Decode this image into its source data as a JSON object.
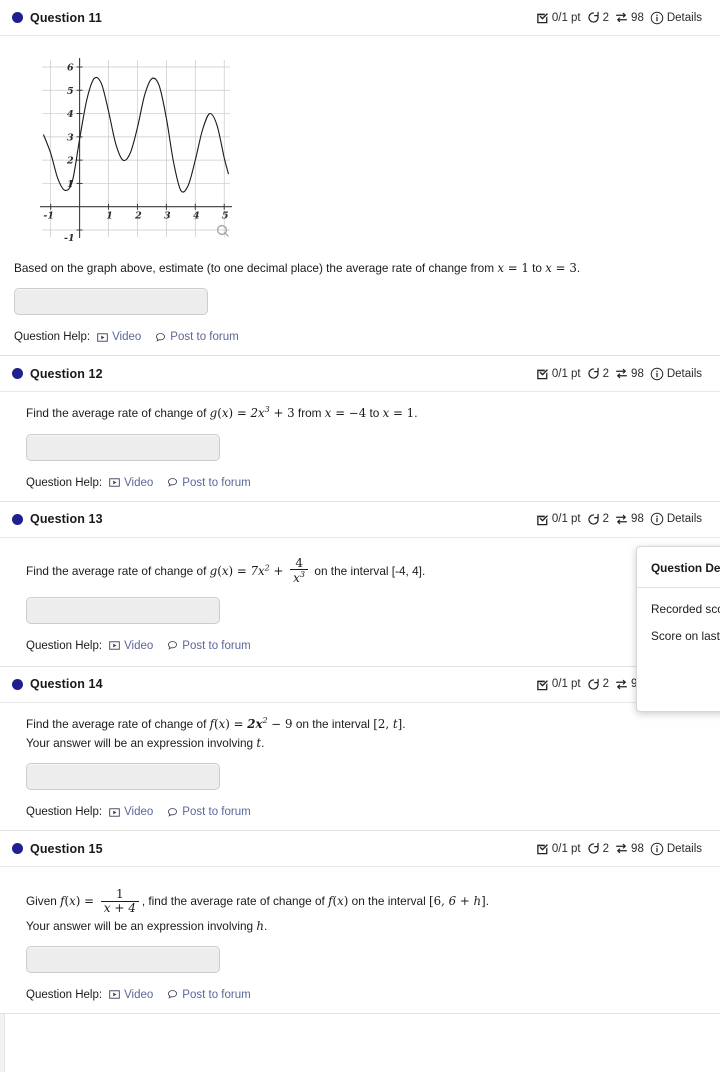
{
  "meta": {
    "score_label": "0/1 pt",
    "attempts": "2",
    "version": "98",
    "details_label": "Details",
    "icons": {
      "status": "checkbox-check-icon",
      "attempts": "undo-arrow-icon",
      "version": "shuffle-arrows-icon",
      "details": "info-circle-icon"
    },
    "bullet_color": "#1f1f8f",
    "link_color": "#5c6699"
  },
  "help": {
    "label": "Question Help:",
    "video_label": "Video",
    "forum_label": "Post to forum",
    "video_icon": "play-video-icon",
    "forum_icon": "speech-bubble-icon"
  },
  "questions": [
    {
      "title": "Question 11",
      "has_graph": true,
      "prompt_line1": "Based on the graph above, estimate (to one decimal place) the average rate of change from ",
      "prompt_math_a": "x",
      "prompt_eq_a": " = ",
      "prompt_val_a": "1",
      "prompt_mid": " to ",
      "prompt_math_b": "x",
      "prompt_eq_b": " = ",
      "prompt_val_b": "3",
      "prompt_end": ".",
      "answer_value": ""
    },
    {
      "title": "Question 12",
      "prompt_pre": "Find the average rate of change of ",
      "fn": "g",
      "var": "x",
      "expr_coef": "2",
      "expr_var": "x",
      "expr_pow": "3",
      "expr_tail": " + 3",
      "interval_pre": " from ",
      "from_var": "x",
      "from_val": " = −4",
      "to_text": " to ",
      "to_var": "x",
      "to_val": " = 1",
      "prompt_end": ".",
      "answer_value": ""
    },
    {
      "title": "Question 13",
      "prompt_pre": "Find the average rate of change of ",
      "fn": "g",
      "var": "x",
      "expr_coef": "7",
      "expr_var": "x",
      "expr_pow": "2",
      "plus": " + ",
      "frac_num": "4",
      "frac_den_var": "x",
      "frac_den_pow": "3",
      "interval_text": " on the interval [-4, 4].",
      "answer_value": ""
    },
    {
      "title": "Question 14",
      "prompt_pre": "Find the average rate of change of ",
      "fn": "f",
      "var": "x",
      "expr_coef": "2",
      "expr_var": "x",
      "expr_pow": "2",
      "expr_tail": " − 9",
      "interval_text": " on the interval ",
      "interval_open": "[",
      "interval_a": "2",
      "interval_comma": ", ",
      "interval_b": "t",
      "interval_close": "]",
      "prompt_end": ".",
      "prompt_line2_pre": "Your answer will be an expression involving ",
      "prompt_line2_var": "t",
      "prompt_line2_end": ".",
      "answer_value": ""
    },
    {
      "title": "Question 15",
      "prompt_pre": "Given ",
      "fn": "f",
      "var": "x",
      "eq": " = ",
      "frac_num": "1",
      "frac_den": "x + 4",
      "prompt_mid": ", find the average rate of change of ",
      "fn2": "f",
      "var2": "x",
      "interval_text": " on the interval ",
      "interval_open": "[",
      "interval_a": "6",
      "interval_comma": ", ",
      "interval_b": "6 + h",
      "interval_close": "]",
      "prompt_end": ".",
      "prompt_line2_pre": "Your answer will be an expression involving ",
      "prompt_line2_var": "h",
      "prompt_line2_end": ".",
      "answer_value": ""
    }
  ],
  "popup": {
    "title": "Question Details",
    "row1": "Recorded score",
    "row2": "Score on last attempt"
  },
  "chart_data": {
    "type": "line",
    "title": "",
    "xlabel": "",
    "ylabel": "",
    "xlim": [
      -1.3,
      5.2
    ],
    "ylim": [
      -1.3,
      6.3
    ],
    "xticks": [
      -1,
      1,
      2,
      3,
      4,
      5
    ],
    "yticks": [
      -1,
      1,
      2,
      3,
      4,
      5,
      6
    ],
    "grid": true,
    "legend": null,
    "zoom_icon": "magnifier-icon",
    "description": "Oscillating curve with decreasing amplitude; peaks near (0.5, 5.5), (2.5, 5.5), (4.5, 4.0); valleys near (-0.5, 0.7), (1.5, 2.0), (3.5, 0.7)",
    "points": [
      {
        "x": -1.25,
        "y": 3.1
      },
      {
        "x": -1.0,
        "y": 2.3
      },
      {
        "x": -0.75,
        "y": 1.2
      },
      {
        "x": -0.5,
        "y": 0.7
      },
      {
        "x": -0.25,
        "y": 1.1
      },
      {
        "x": 0.0,
        "y": 2.9
      },
      {
        "x": 0.25,
        "y": 4.6
      },
      {
        "x": 0.5,
        "y": 5.5
      },
      {
        "x": 0.75,
        "y": 5.3
      },
      {
        "x": 1.0,
        "y": 4.1
      },
      {
        "x": 1.25,
        "y": 2.7
      },
      {
        "x": 1.5,
        "y": 2.0
      },
      {
        "x": 1.75,
        "y": 2.3
      },
      {
        "x": 2.0,
        "y": 3.4
      },
      {
        "x": 2.25,
        "y": 4.8
      },
      {
        "x": 2.5,
        "y": 5.5
      },
      {
        "x": 2.75,
        "y": 5.2
      },
      {
        "x": 3.0,
        "y": 3.8
      },
      {
        "x": 3.25,
        "y": 1.9
      },
      {
        "x": 3.5,
        "y": 0.7
      },
      {
        "x": 3.75,
        "y": 0.9
      },
      {
        "x": 4.0,
        "y": 2.0
      },
      {
        "x": 4.25,
        "y": 3.3
      },
      {
        "x": 4.5,
        "y": 4.0
      },
      {
        "x": 4.75,
        "y": 3.5
      },
      {
        "x": 5.0,
        "y": 2.1
      },
      {
        "x": 5.15,
        "y": 1.4
      }
    ]
  }
}
